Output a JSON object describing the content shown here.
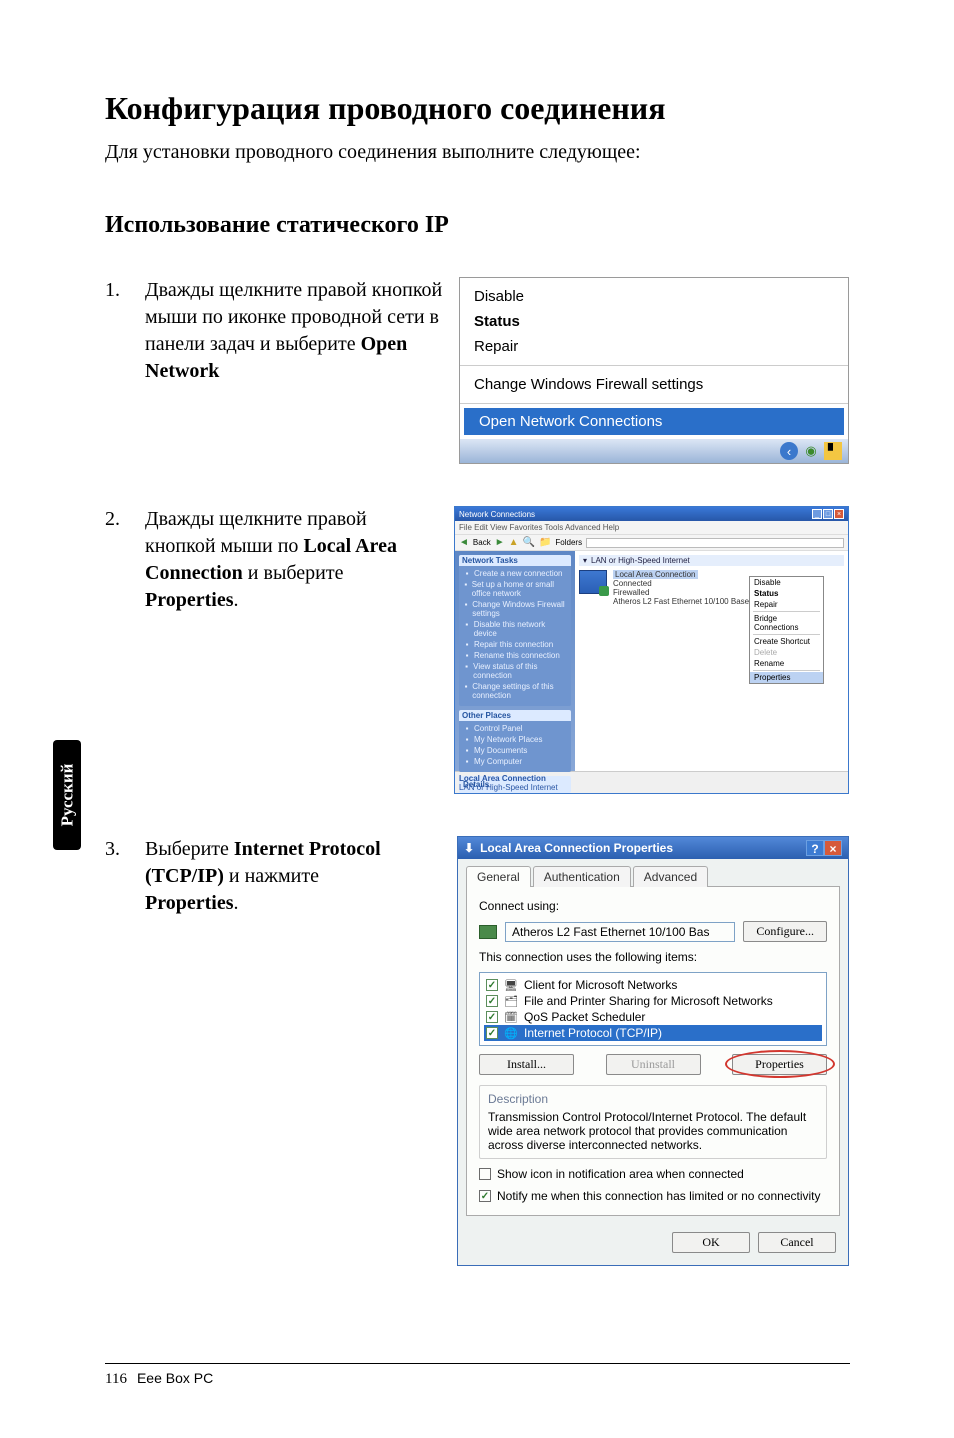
{
  "heading": "Конфигурация проводного соединения",
  "intro": "Для установки проводного соединения выполните следующее:",
  "subheading": "Использование статического  IP",
  "step1": {
    "num": "1.",
    "text_pre": "Дважды щелкните правой кнопкой мыши по иконке проводной сети  в панели задач и выберите ",
    "bold": "Open Network"
  },
  "step2": {
    "num": "2.",
    "text_pre": "Дважды щелкните правой кнопкой мыши по ",
    "bold1": "Local Area Connection",
    "mid1": " и выберите",
    "bold2": "Properties",
    "mid2": "."
  },
  "step3": {
    "num": "3.",
    "text_pre": "Выберите ",
    "bold1": "Internet Protocol (TCP/IP)",
    "mid1": " и нажмите ",
    "bold2": "Properties",
    "mid2": "."
  },
  "ctx_menu": {
    "disable": "Disable",
    "status": "Status",
    "repair": "Repair",
    "change_fw": "Change Windows Firewall settings",
    "open_nc": "Open Network Connections"
  },
  "ncwin": {
    "title": "Network Connections",
    "menubar": "File   Edit   View   Favorites   Tools   Advanced   Help",
    "back": "Back",
    "folders": "Folders",
    "groupbar": "LAN or High-Speed Internet",
    "tasks_hdr": "Network Tasks",
    "tasks": [
      "Create a new connection",
      "Set up a home or small office network",
      "Change Windows Firewall settings",
      "Disable this network device",
      "Repair this connection",
      "Rename this connection",
      "View status of this connection",
      "Change settings of this connection"
    ],
    "other_hdr": "Other Places",
    "other": [
      "Control Panel",
      "My Network Places",
      "My Documents",
      "My Computer"
    ],
    "details_hdr": "Details",
    "details1": "Local Area Connection",
    "details2": "LAN or High-Speed Internet",
    "lac_name": "Local Area Connection",
    "lac_status": "Connected",
    "lac_fw": "Firewalled",
    "lac_adapter": "Atheros L2 Fast Ethernet 10/100 Base",
    "ctx": {
      "disable": "Disable",
      "status": "Status",
      "repair": "Repair",
      "bridge": "Bridge Connections",
      "shortcut": "Create Shortcut",
      "delete": "Delete",
      "rename": "Rename",
      "properties": "Properties"
    }
  },
  "propdlg": {
    "title": "Local Area Connection Properties",
    "tabs": {
      "general": "General",
      "auth": "Authentication",
      "adv": "Advanced"
    },
    "connect_using": "Connect using:",
    "adapter": "Atheros L2 Fast Ethernet 10/100 Bas",
    "configure": "Configure...",
    "uses": "This connection uses the following items:",
    "items": {
      "client": "Client for Microsoft Networks",
      "fps": "File and Printer Sharing for Microsoft Networks",
      "qos": "QoS Packet Scheduler",
      "tcpip": "Internet Protocol (TCP/IP)"
    },
    "install": "Install...",
    "uninstall": "Uninstall",
    "properties": "Properties",
    "desc_hdr": "Description",
    "desc": "Transmission Control Protocol/Internet Protocol. The default wide area network protocol that provides communication across diverse interconnected networks.",
    "show_icon": "Show icon in notification area when connected",
    "notify": "Notify me when this connection has limited or no connectivity",
    "ok": "OK",
    "cancel": "Cancel"
  },
  "side_tab": "Русский",
  "footer": {
    "page_num": "116",
    "doc": "Eee Box PC"
  }
}
